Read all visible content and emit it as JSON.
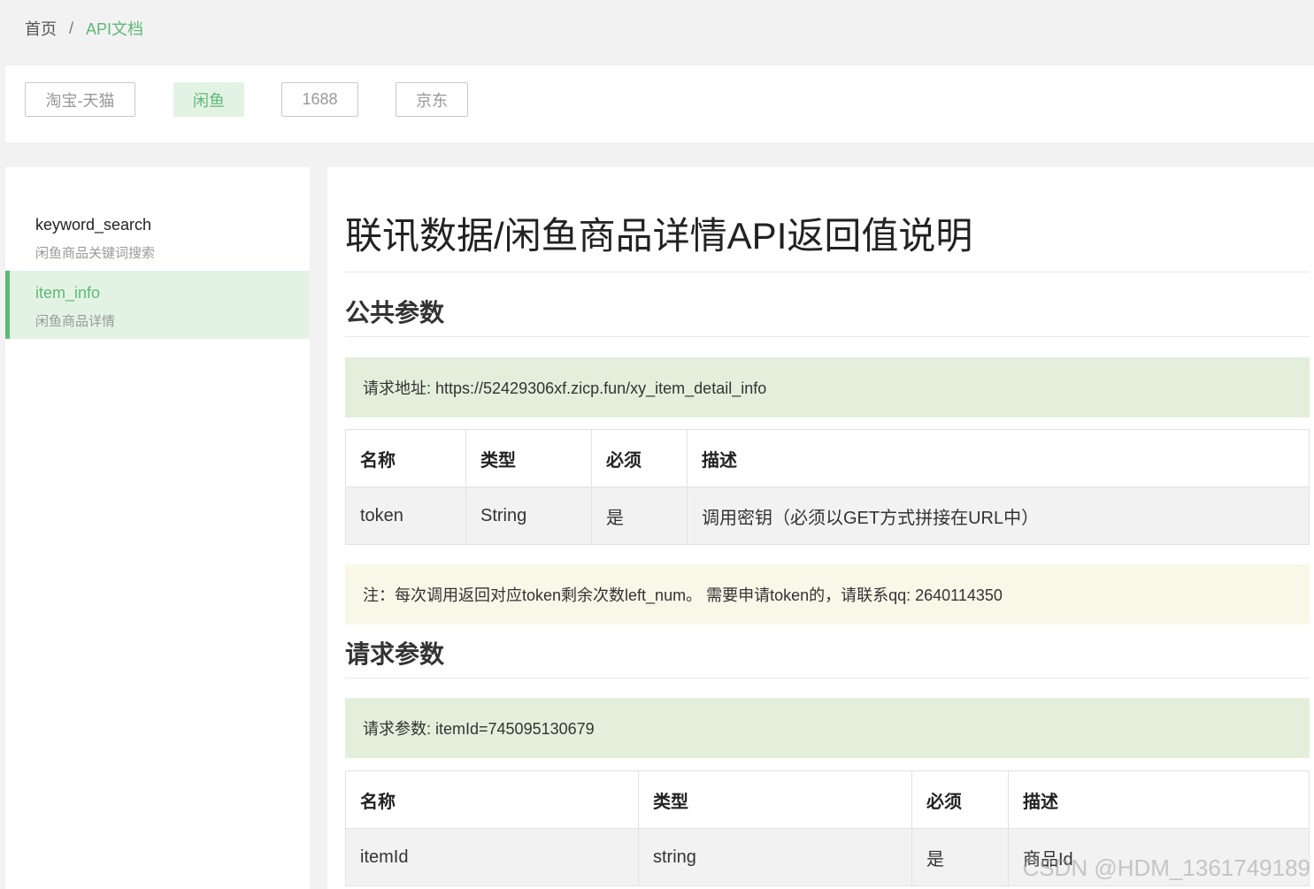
{
  "breadcrumb": {
    "home": "首页",
    "sep": "/",
    "current": "API文档"
  },
  "tabs": [
    {
      "label": "淘宝-天猫"
    },
    {
      "label": "闲鱼"
    },
    {
      "label": "1688"
    },
    {
      "label": "京东"
    }
  ],
  "sidebar": {
    "items": [
      {
        "title": "keyword_search",
        "sub": "闲鱼商品关键词搜索"
      },
      {
        "title": "item_info",
        "sub": "闲鱼商品详情"
      }
    ]
  },
  "main": {
    "title": "联讯数据/闲鱼商品详情API返回值说明",
    "public_params": {
      "heading": "公共参数",
      "url_notice": "请求地址: https://52429306xf.zicp.fun/xy_item_detail_info",
      "headers": [
        "名称",
        "类型",
        "必须",
        "描述"
      ],
      "rows": [
        [
          "token",
          "String",
          "是",
          "调用密钥（必须以GET方式拼接在URL中）"
        ]
      ],
      "note": "注：每次调用返回对应token剩余次数left_num。 需要申请token的，请联系qq: 2640114350"
    },
    "request_params": {
      "heading": "请求参数",
      "example": "请求参数: itemId=745095130679",
      "headers": [
        "名称",
        "类型",
        "必须",
        "描述"
      ],
      "rows": [
        [
          "itemId",
          "string",
          "是",
          "商品Id"
        ]
      ]
    }
  },
  "watermark": "CSDN @HDM_1361749189"
}
